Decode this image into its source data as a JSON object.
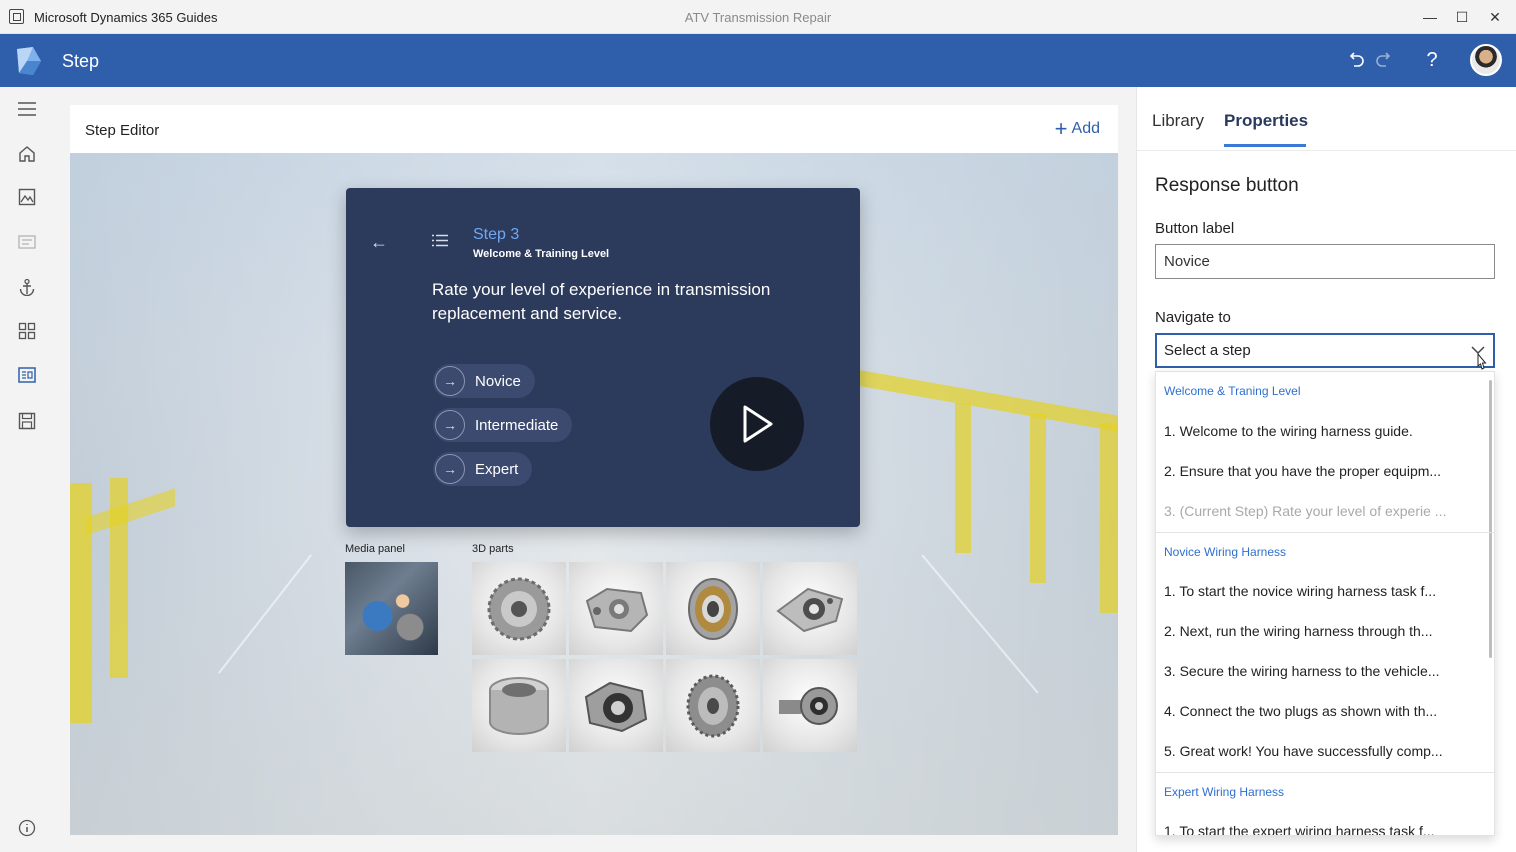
{
  "window": {
    "app_name": "Microsoft Dynamics 365 Guides",
    "document_title": "ATV Transmission Repair",
    "minimize_glyph": "—",
    "maximize_glyph": "☐",
    "close_glyph": "✕"
  },
  "header": {
    "title": "Step",
    "brand_color": "#2f5faa"
  },
  "rail": {
    "icons": [
      "menu-icon",
      "home-icon",
      "image-icon",
      "text-icon",
      "anchor-icon",
      "grid-icon",
      "step-card-icon",
      "save-icon",
      "info-icon"
    ]
  },
  "editor": {
    "title": "Step Editor",
    "add_label": "Add",
    "card": {
      "step_number": "Step 3",
      "step_subtitle": "Welcome & Training Level",
      "question": "Rate your level of experience in transmission replacement and service.",
      "responses": [
        "Novice",
        "Intermediate",
        "Expert"
      ]
    },
    "media_panel_label": "Media panel",
    "parts_label": "3D parts"
  },
  "properties": {
    "tabs": [
      "Library",
      "Properties"
    ],
    "active_tab": "Properties",
    "section_title": "Response button",
    "button_label_title": "Button label",
    "button_label_value": "Novice",
    "navigate_title": "Navigate to",
    "navigate_placeholder": "Select a step",
    "groups": [
      {
        "name": "Welcome & Traning Level",
        "items": [
          {
            "text": "1. Welcome to the wiring harness guide.",
            "disabled": false
          },
          {
            "text": "2. Ensure that you have the proper equipm...",
            "disabled": false
          },
          {
            "text": "3. (Current Step) Rate your level of experie ...",
            "disabled": true
          }
        ]
      },
      {
        "name": "Novice Wiring Harness",
        "items": [
          {
            "text": "1. To start the novice wiring harness task f...",
            "disabled": false
          },
          {
            "text": "2. Next, run the wiring harness through th...",
            "disabled": false
          },
          {
            "text": "3. Secure the wiring harness to the vehicle...",
            "disabled": false
          },
          {
            "text": "4. Connect the two plugs as shown with th...",
            "disabled": false
          },
          {
            "text": "5. Great work! You have successfully comp...",
            "disabled": false
          }
        ]
      },
      {
        "name": "Expert Wiring Harness",
        "items": [
          {
            "text": "1. To start the expert wiring harness task f...",
            "disabled": false
          }
        ]
      }
    ]
  }
}
